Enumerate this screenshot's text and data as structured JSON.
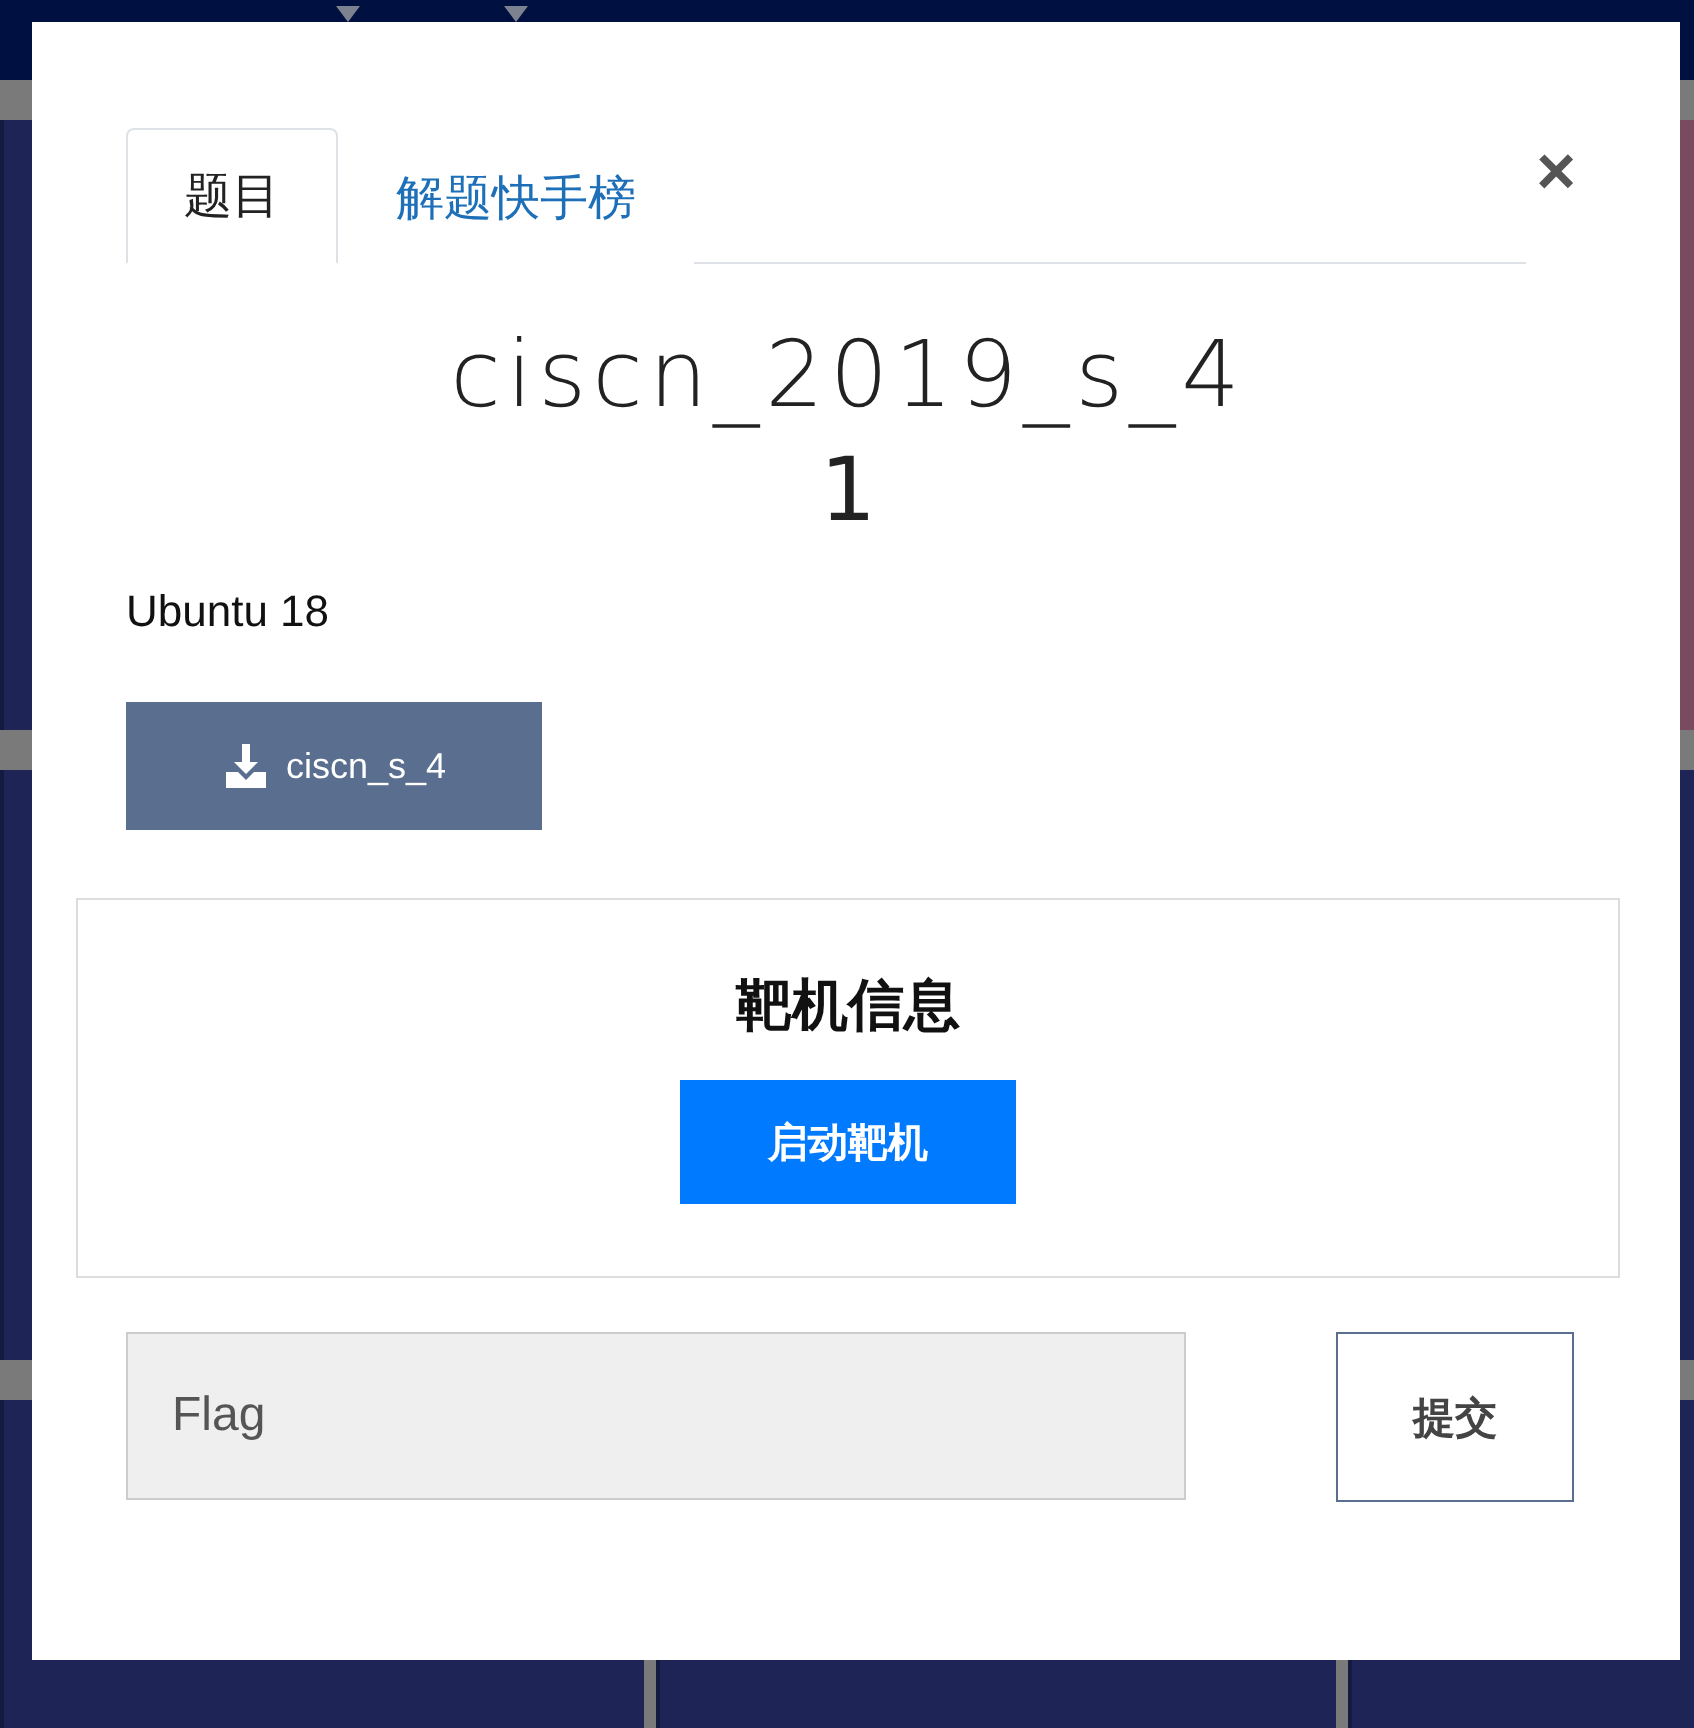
{
  "cards": [
    {
      "color": "#1e2556"
    },
    {
      "color": "#7a4a60"
    },
    {
      "color": "#1e2556"
    },
    {
      "color": "#1e2556"
    },
    {
      "color": "#1e2556"
    },
    {
      "color": "#1e2556"
    },
    {
      "color": "#1e2556"
    }
  ],
  "modal": {
    "tabs": [
      {
        "label": "题目",
        "selected": true
      },
      {
        "label": "解题快手榜",
        "selected": false
      }
    ],
    "close": "×",
    "title": "ciscn_2019_s_4",
    "score": "1",
    "description": "Ubuntu 18",
    "download": "ciscn_s_4",
    "target": {
      "title": "靶机信息",
      "button": "启动靶机"
    },
    "flag": {
      "placeholder": "Flag"
    },
    "submit": "提交"
  }
}
